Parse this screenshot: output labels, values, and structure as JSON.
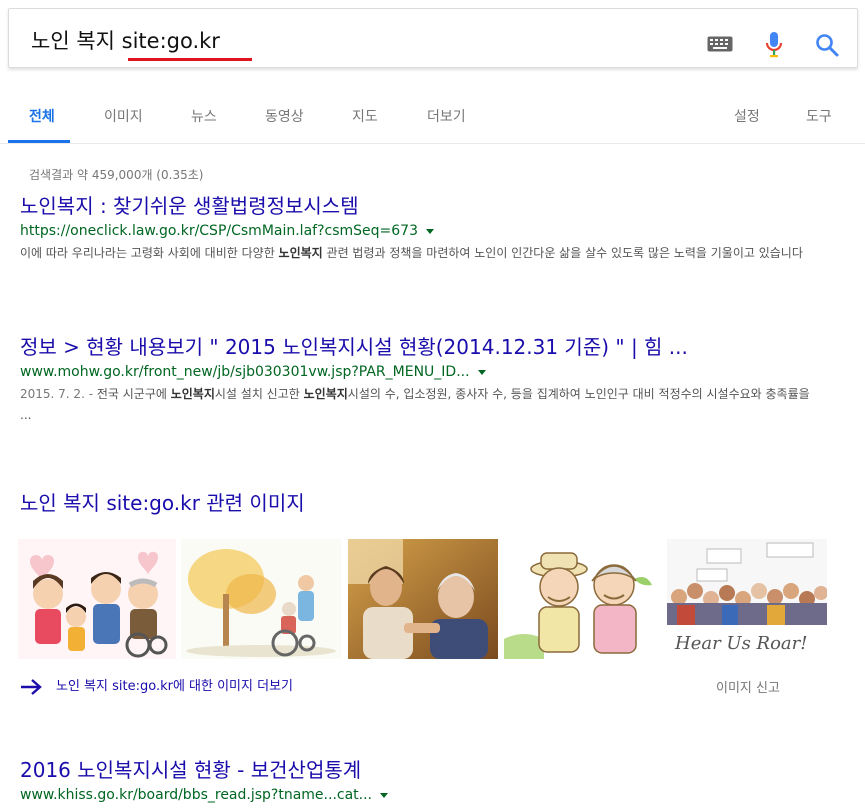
{
  "search": {
    "query_plain": "노인 복지 ",
    "query_site": "site:go.kr"
  },
  "tabs": [
    {
      "label": "전체",
      "active": true
    },
    {
      "label": "이미지"
    },
    {
      "label": "뉴스"
    },
    {
      "label": "동영상"
    },
    {
      "label": "지도"
    },
    {
      "label": "더보기"
    },
    {
      "label": "설정"
    },
    {
      "label": "도구"
    }
  ],
  "stats": "검색결과 약 459,000개 (0.35초)",
  "results": [
    {
      "title": "노인복지 : 찾기쉬운 생활법령정보시스템",
      "url": "https://oneclick.law.go.kr/CSP/CsmMain.laf?csmSeq=673",
      "snippet_1": "이에 따라 우리나라는 고령화 사회에 대비한 다양한 ",
      "snippet_bold": "노인복지",
      "snippet_2": " 관련 법령과 정책을 마련하여 노인이 인간다운 삶을 살수 있도록 많은 노력을 기울이고 있습니다"
    },
    {
      "title": "정보 > 현황 내용보기 \" 2015 노인복지시설 현황(2014.12.31 기준) \" | 힘 ...",
      "url": "www.mohw.go.kr/front_new/jb/sjb030301vw.jsp?PAR_MENU_ID...",
      "date": "2015. 7. 2. - ",
      "snippet_1": "전국 시군구에 ",
      "snippet_bold": "노인복지",
      "snippet_2": "시설 설치 신고한 ",
      "snippet_bold_2": "노인복지",
      "snippet_3": "시설의 수, 입소정원, 종사자 수, 등을 집계하여 노인인구 대비 적정수의 시설수요와 충족률을 ..."
    },
    {
      "title": "2016 노인복지시설 현황 - 보건산업통계",
      "url": "www.khiss.go.kr/board/bbs_read.jsp?tname...cat..."
    }
  ],
  "images": {
    "title": "노인 복지 site:go.kr 관련 이미지",
    "more_label": "노인 복지 site:go.kr에 대한 이미지 더보기",
    "report_label": "이미지 신고",
    "thumb_5_text": "Hear Us Roar!"
  }
}
